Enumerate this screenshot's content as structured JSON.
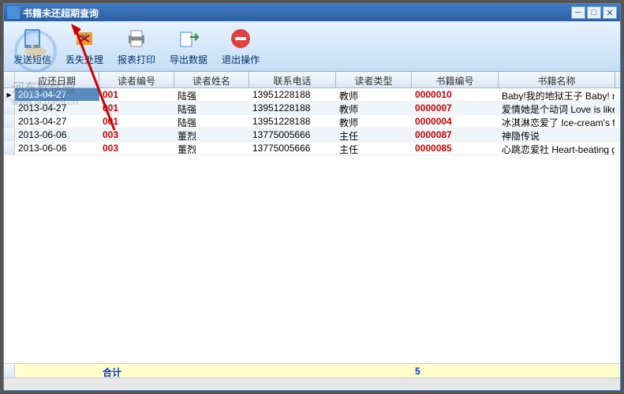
{
  "window": {
    "title": "书籍未还超期查询"
  },
  "toolbar": {
    "sms": "发送短信",
    "lost": "丢失处理",
    "print": "报表打印",
    "export": "导出数据",
    "exit": "退出操作"
  },
  "columns": {
    "date": "应还日期",
    "reader_id": "读者编号",
    "reader_name": "读者姓名",
    "phone": "联系电话",
    "reader_type": "读者类型",
    "book_id": "书籍编号",
    "book_name": "书籍名称"
  },
  "rows": [
    {
      "date": "2013-04-27",
      "reader_id": "001",
      "reader_name": "陆强",
      "phone": "13951228188",
      "reader_type": "教师",
      "book_id": "0000010",
      "book_name": "Baby!我的地狱王子 Baby! my he"
    },
    {
      "date": "2013-04-27",
      "reader_id": "001",
      "reader_name": "陆强",
      "phone": "13951228188",
      "reader_type": "教师",
      "book_id": "0000007",
      "book_name": "爱情她是个动词 Love is like a"
    },
    {
      "date": "2013-04-27",
      "reader_id": "001",
      "reader_name": "陆强",
      "phone": "13951228188",
      "reader_type": "教师",
      "book_id": "0000004",
      "book_name": "冰淇淋恋爱了 Ice-cream's fall"
    },
    {
      "date": "2013-06-06",
      "reader_id": "003",
      "reader_name": "董烈",
      "phone": "13775005666",
      "reader_type": "主任",
      "book_id": "0000087",
      "book_name": "神隐传说"
    },
    {
      "date": "2013-06-06",
      "reader_id": "003",
      "reader_name": "董烈",
      "phone": "13775005666",
      "reader_type": "主任",
      "book_id": "0000085",
      "book_name": "心跳恋爱社 Heart-beating grou"
    }
  ],
  "footer": {
    "label": "合计",
    "count": "5"
  },
  "watermark": {
    "text": "河东软件园",
    "url": "www.pc0359.cn"
  }
}
